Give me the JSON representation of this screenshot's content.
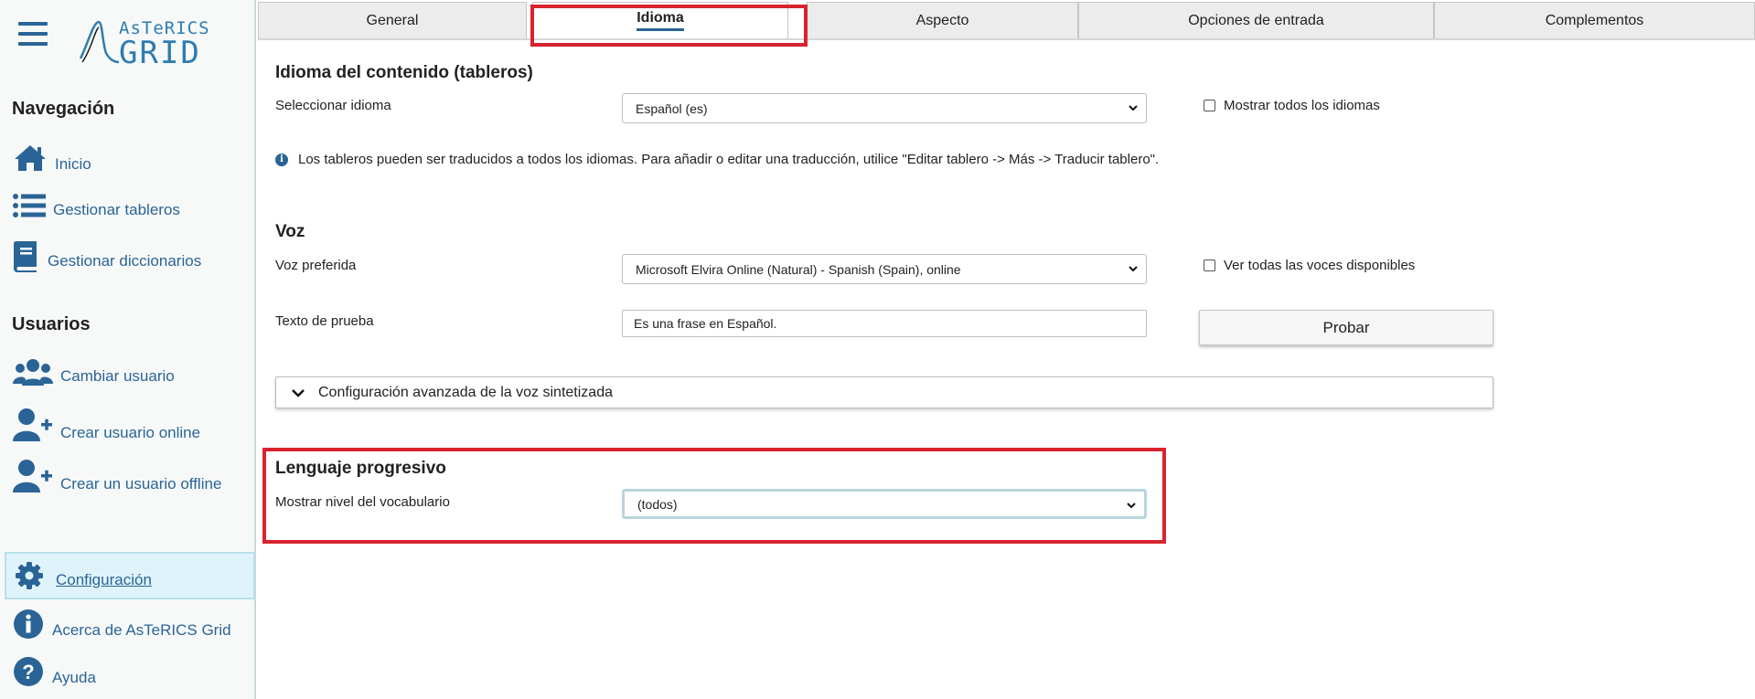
{
  "logo": {
    "top": "AsTeRICS",
    "bottom": "GRID"
  },
  "sidebar": {
    "nav_heading": "Navegación",
    "nav_items": [
      {
        "label": "Inicio",
        "icon": "home-icon"
      },
      {
        "label": "Gestionar tableros",
        "icon": "list-icon"
      },
      {
        "label": "Gestionar diccionarios",
        "icon": "book-icon"
      }
    ],
    "users_heading": "Usuarios",
    "user_items": [
      {
        "label": "Cambiar usuario",
        "icon": "users-icon"
      },
      {
        "label": "Crear usuario online",
        "icon": "user-plus-icon"
      },
      {
        "label": "Crear un usuario offline",
        "icon": "user-plus-icon"
      }
    ],
    "bottom_items": [
      {
        "label": "Configuración",
        "icon": "gear-icon",
        "active": true
      },
      {
        "label": "Acerca de AsTeRICS Grid",
        "icon": "info-icon"
      },
      {
        "label": "Ayuda",
        "icon": "help-icon"
      }
    ]
  },
  "tabs": [
    {
      "label": "General"
    },
    {
      "label": "Idioma",
      "active": true
    },
    {
      "label": "Aspecto"
    },
    {
      "label": "Opciones de entrada"
    },
    {
      "label": "Complementos"
    }
  ],
  "language": {
    "title": "Idioma del contenido (tableros)",
    "select_label": "Seleccionar idioma",
    "select_value": "Español (es)",
    "show_all_label": "Mostrar todos los idiomas",
    "info_text": "Los tableros pueden ser traducidos a todos los idiomas. Para añadir o editar una traducción, utilice \"Editar tablero -> Más -> Traducir tablero\"."
  },
  "voice": {
    "title": "Voz",
    "preferred_label": "Voz preferida",
    "preferred_value": "Microsoft Elvira Online (Natural) - Spanish (Spain), online",
    "show_all_label": "Ver todas las voces disponibles",
    "test_label": "Texto de prueba",
    "test_value": "Es una frase en Español.",
    "test_button": "Probar",
    "advanced_label": "Configuración avanzada de la voz sintetizada"
  },
  "progressive": {
    "title": "Lenguaje progresivo",
    "level_label": "Mostrar nivel del vocabulario",
    "level_value": "(todos)"
  },
  "colors": {
    "accent": "#2a6496",
    "highlight": "#d9232e",
    "active_bg": "#dff3fa"
  }
}
